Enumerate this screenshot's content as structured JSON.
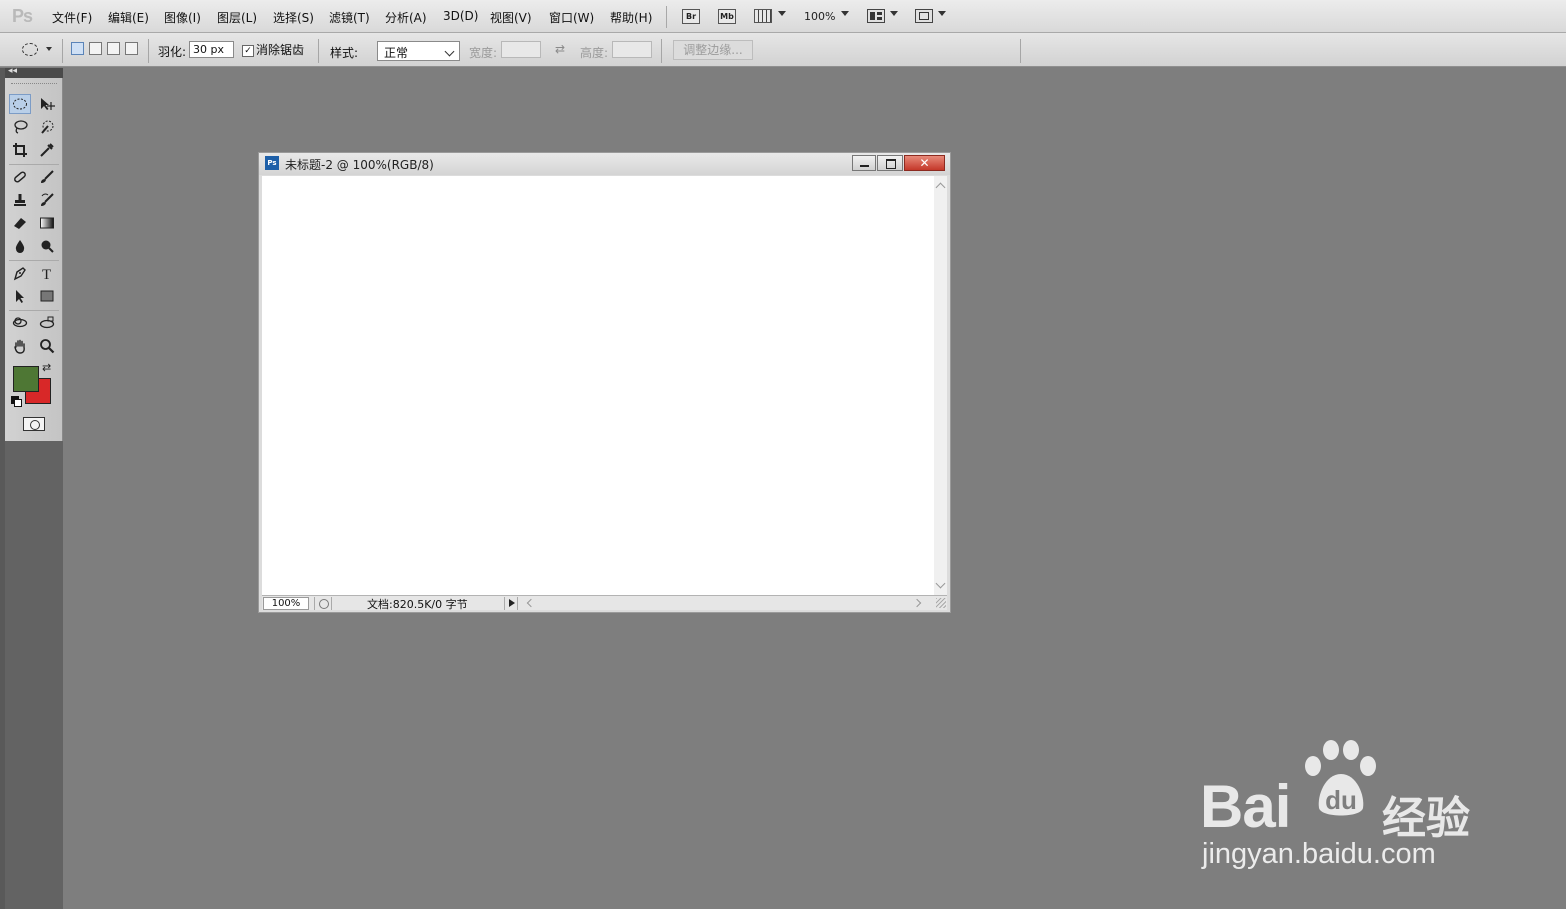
{
  "app": {
    "logo": "Ps"
  },
  "menu": {
    "items": [
      "文件(F)",
      "编辑(E)",
      "图像(I)",
      "图层(L)",
      "选择(S)",
      "滤镜(T)",
      "分析(A)",
      "3D(D)",
      "视图(V)",
      "窗口(W)",
      "帮助(H)"
    ],
    "bridge_label": "Br",
    "minibridge_label": "Mb",
    "zoom": "100%"
  },
  "options": {
    "feather_label": "羽化:",
    "feather_value": "30 px",
    "antialias_label": "消除锯齿",
    "antialias_checked": true,
    "style_label": "样式:",
    "style_value": "正常",
    "width_label": "宽度:",
    "height_label": "高度:",
    "refine_edge": "调整边缘..."
  },
  "toolbox": {
    "collapse_glyph": "◂◂",
    "foreground_color": "#4e7734",
    "background_color": "#d82828",
    "active_tool": "elliptical-marquee"
  },
  "document": {
    "icon_label": "Ps",
    "title": "未标题-2 @ 100%(RGB/8)",
    "close_glyph": "✕",
    "zoom": "100%",
    "info": "文档:820.5K/0 字节"
  },
  "watermark": {
    "brand": "Bai",
    "brand_paw_text": "du",
    "brand_cn": "经验",
    "url": "jingyan.baidu.com"
  }
}
